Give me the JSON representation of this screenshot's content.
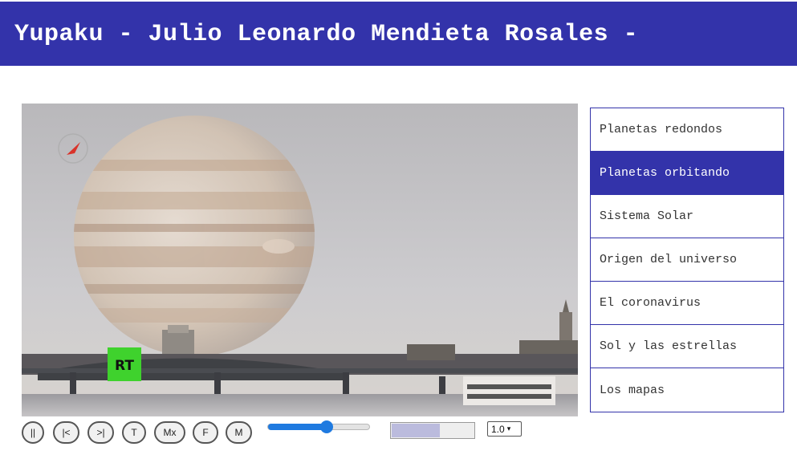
{
  "header": {
    "title": "Yupaku - Julio Leonardo Mendieta Rosales -",
    "background_color": "#3333aa"
  },
  "video": {
    "channel_logo_text": "RT",
    "scene": "jupiter-over-city-bridge"
  },
  "controls": {
    "buttons": [
      {
        "label": "||",
        "name": "pause-button"
      },
      {
        "label": "|<",
        "name": "previous-button"
      },
      {
        "label": ">|",
        "name": "next-button"
      },
      {
        "label": "T",
        "name": "t-button"
      },
      {
        "label": "Mx",
        "name": "mx-button"
      },
      {
        "label": "F",
        "name": "f-button"
      },
      {
        "label": "M",
        "name": "m-button"
      }
    ],
    "volume": 0.58,
    "progress": 0.6,
    "speed": "1.0",
    "accent_color": "#1f7ae0"
  },
  "playlist": {
    "items": [
      {
        "label": "Planetas redondos",
        "active": false
      },
      {
        "label": "Planetas orbitando",
        "active": true
      },
      {
        "label": "Sistema Solar",
        "active": false
      },
      {
        "label": "Origen del universo",
        "active": false
      },
      {
        "label": "El coronavirus",
        "active": false
      },
      {
        "label": "Sol y las estrellas",
        "active": false
      },
      {
        "label": "Los mapas",
        "active": false
      }
    ]
  }
}
